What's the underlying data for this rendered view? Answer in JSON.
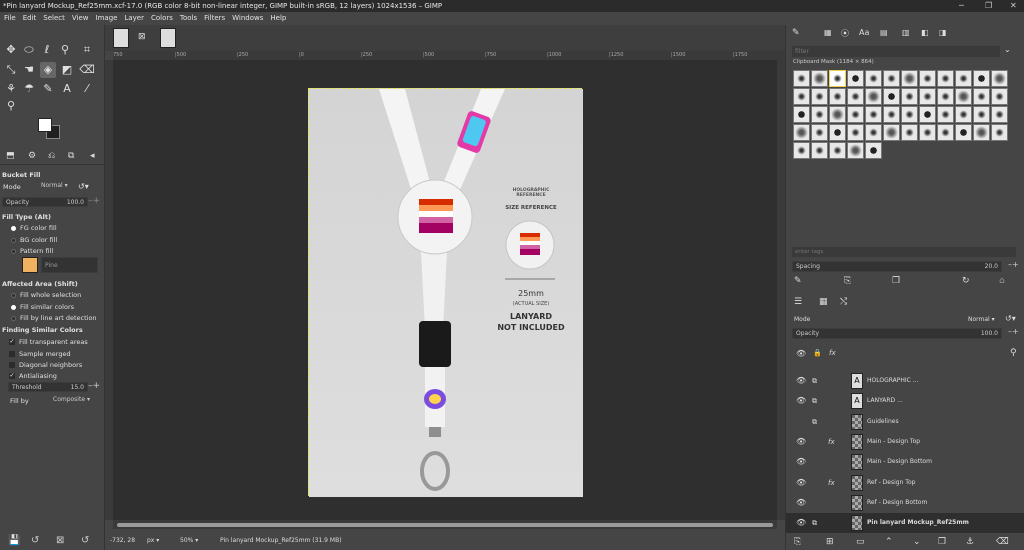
{
  "window": {
    "title": "*Pin lanyard Mockup_Ref25mm.xcf-17.0 (RGB color 8-bit non-linear integer, GIMP built-in sRGB, 12 layers) 1024x1536 – GIMP"
  },
  "menu": [
    "File",
    "Edit",
    "Select",
    "View",
    "Image",
    "Layer",
    "Colors",
    "Tools",
    "Filters",
    "Windows",
    "Help"
  ],
  "tool_options": {
    "title": "Bucket Fill",
    "mode_label": "Mode",
    "mode_value": "Normal",
    "opacity_label": "Opacity",
    "opacity_value": "100.0",
    "fill_type_header": "Fill Type  (Alt)",
    "fill_types": [
      "FG color fill",
      "BG color fill",
      "Pattern fill"
    ],
    "pattern_name": "Pine",
    "affected_header": "Affected Area  (Shift)",
    "affected": [
      "Fill whole selection",
      "Fill similar colors",
      "Fill by line art detection"
    ],
    "similar_header": "Finding Similar Colors",
    "similar": [
      "Fill transparent areas",
      "Sample merged",
      "Diagonal neighbors",
      "Antialiasing"
    ],
    "threshold_label": "Threshold",
    "threshold_value": "15.0",
    "fillby_label": "Fill by",
    "fillby_value": "Composite"
  },
  "ruler_ticks": [
    "750",
    "|500",
    "|250",
    "|0",
    "|250",
    "|500",
    "|750",
    "|1000",
    "|1250",
    "|1500",
    "|1750"
  ],
  "canvas": {
    "holo_label": "HOLOGRAPHIC\nREFERENCE",
    "size_ref": "SIZE REFERENCE",
    "size_value": "25mm",
    "actual_size": "(ACTUAL SIZE)",
    "lanyard_line1": "LANYARD",
    "lanyard_line2": "NOT INCLUDED"
  },
  "status": {
    "coords": "-732, 28",
    "unit": "px",
    "zoom": "50%",
    "info": "Pin lanyard Mockup_Ref25mm (31.9 MB)"
  },
  "brushes": {
    "filter_placeholder": "filter",
    "brush_name": "Clipboard Mask (1184 × 864)",
    "tags_placeholder": "enter tags",
    "spacing_label": "Spacing",
    "spacing_value": "20.0"
  },
  "layers": {
    "mode_label": "Mode",
    "mode_value": "Normal",
    "opacity_label": "Opacity",
    "opacity_value": "100.0",
    "items": [
      {
        "name": "HOLOGRAPHIC ...",
        "eye": true,
        "lock": true,
        "fx": false,
        "text": true
      },
      {
        "name": "LANYARD ...",
        "eye": true,
        "lock": true,
        "fx": false,
        "text": true
      },
      {
        "name": "Guidelines",
        "eye": false,
        "lock": true,
        "fx": false,
        "text": false
      },
      {
        "name": "Main - Design Top",
        "eye": true,
        "lock": false,
        "fx": true,
        "text": false
      },
      {
        "name": "Main - Design Bottom",
        "eye": true,
        "lock": false,
        "fx": false,
        "text": false
      },
      {
        "name": "Ref - Design Top",
        "eye": true,
        "lock": false,
        "fx": true,
        "text": false
      },
      {
        "name": "Ref - Design Bottom",
        "eye": true,
        "lock": false,
        "fx": false,
        "text": false
      },
      {
        "name": "Pin lanyard Mockup_Ref25mm",
        "eye": true,
        "lock": true,
        "fx": false,
        "text": false,
        "selected": true
      }
    ]
  },
  "colors": {
    "accent": "#e8e84a",
    "pattern": "#f2b15e",
    "flag": [
      "#d52d00",
      "#ef7627",
      "#ff9a56",
      "#ffffff",
      "#d162a4",
      "#b55690",
      "#a30262"
    ]
  }
}
